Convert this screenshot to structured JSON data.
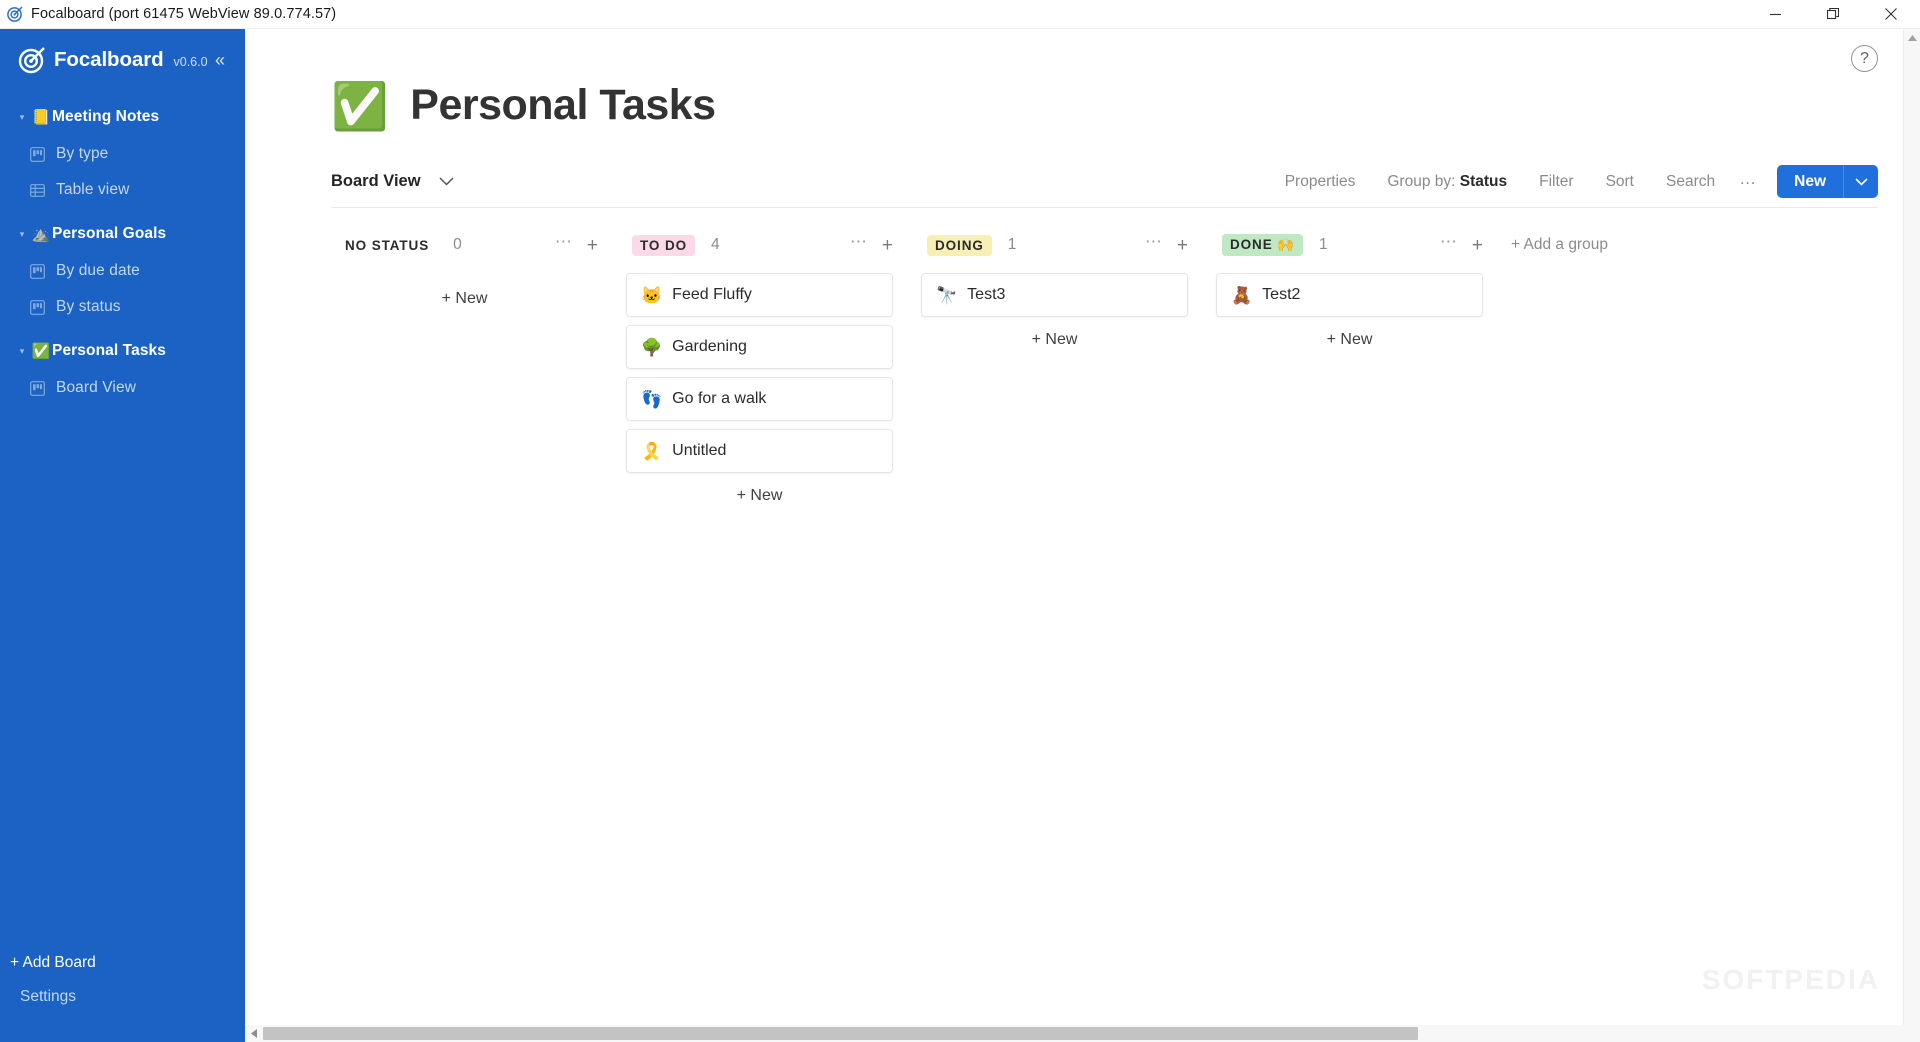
{
  "window": {
    "title": "Focalboard (port 61475 WebView 89.0.774.57)",
    "app_icon": "focalboard-target-icon",
    "controls": {
      "minimize": "—",
      "restore": "❐",
      "close": "✕"
    }
  },
  "sidebar": {
    "brand": "Focalboard",
    "version": "v0.6.0",
    "collapse_icon": "«",
    "boards": [
      {
        "name": "Meeting Notes",
        "emoji": "📒",
        "caret": "▾",
        "views": [
          {
            "name": "By type",
            "icon": "board-view-icon"
          },
          {
            "name": "Table view",
            "icon": "table-view-icon"
          }
        ]
      },
      {
        "name": "Personal Goals",
        "emoji": "⛰️",
        "caret": "▾",
        "views": [
          {
            "name": "By due date",
            "icon": "board-view-icon"
          },
          {
            "name": "By status",
            "icon": "board-view-icon"
          }
        ]
      },
      {
        "name": "Personal Tasks",
        "emoji": "✅",
        "caret": "▾",
        "views": [
          {
            "name": "Board View",
            "icon": "board-view-icon"
          }
        ]
      }
    ],
    "add_board": "+ Add Board",
    "settings": "Settings",
    "background_color": "#1b62c4"
  },
  "header": {
    "help_icon": "?",
    "page_emoji": "✅",
    "page_title": "Personal Tasks"
  },
  "toolbar": {
    "view_name": "Board View",
    "view_chevron": "chevron-down-icon",
    "properties": "Properties",
    "group_by_label": "Group by:",
    "group_by_value": "Status",
    "filter": "Filter",
    "sort": "Sort",
    "search": "Search",
    "more": "…",
    "new_label": "New",
    "new_chevron": "chevron-down-icon",
    "accent_color": "#1f6fdd"
  },
  "board": {
    "add_group": "+ Add a group",
    "new_card_label": "+ New",
    "columns": [
      {
        "title": "No status",
        "count": "0",
        "badge_bg": "transparent",
        "badge_fg": "#2b2b2b",
        "cards": []
      },
      {
        "title": "To Do",
        "count": "4",
        "badge_bg": "#fbd9e7",
        "badge_fg": "#2b2b2b",
        "cards": [
          {
            "emoji": "🐱",
            "title": "Feed Fluffy"
          },
          {
            "emoji": "🌳",
            "title": "Gardening"
          },
          {
            "emoji": "👣",
            "title": "Go for a walk"
          },
          {
            "emoji": "🎗️",
            "title": "Untitled"
          }
        ]
      },
      {
        "title": "Doing",
        "count": "1",
        "badge_bg": "#f7efb4",
        "badge_fg": "#2b2b2b",
        "cards": [
          {
            "emoji": "🔭",
            "title": "Test3"
          }
        ]
      },
      {
        "title": "Done 🙌",
        "count": "1",
        "badge_bg": "#bfe8c3",
        "badge_fg": "#2b2b2b",
        "cards": [
          {
            "emoji": "🧸",
            "title": "Test2"
          }
        ]
      }
    ]
  },
  "watermark": "SOFTPEDIA",
  "scrollbars": {
    "vertical_up": "▲",
    "horizontal_left": "◀"
  }
}
